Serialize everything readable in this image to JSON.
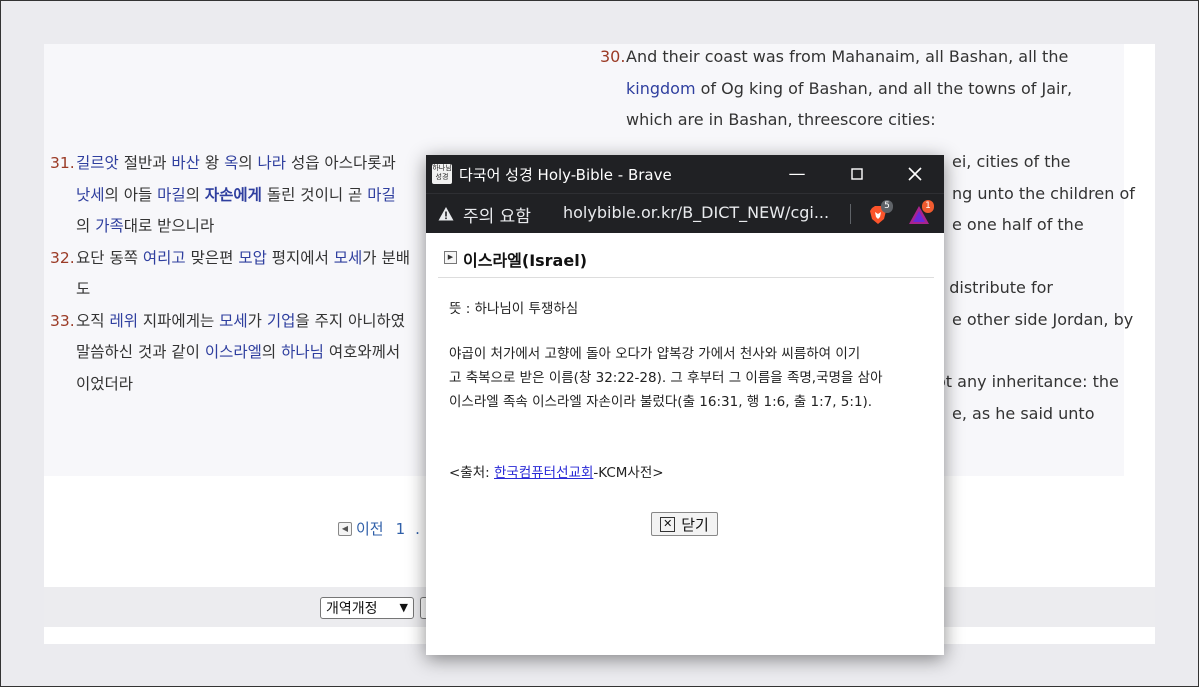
{
  "colors": {
    "verse_number": "#9b3b26",
    "word_link": "#2f3f9f",
    "titlebar": "#202124"
  },
  "korean_verses": [
    {
      "num": "31.",
      "parts": [
        {
          "t": "길르앗",
          "link": true
        },
        {
          "t": " 절반과 "
        },
        {
          "t": "바산",
          "link": true
        },
        {
          "t": " 왕 "
        },
        {
          "t": "옥",
          "link": true
        },
        {
          "t": "의 "
        },
        {
          "t": "나라",
          "link": true
        },
        {
          "t": " 성읍 아스다롯과"
        },
        {
          "br": true
        },
        {
          "t": "낫세",
          "link": true
        },
        {
          "t": "의 아들 "
        },
        {
          "t": "마길",
          "link": true
        },
        {
          "t": "의 "
        },
        {
          "t": "자손에게",
          "link": true,
          "bold": true
        },
        {
          "t": " 돌린 것이니 곧 "
        },
        {
          "t": "마길",
          "link": true
        },
        {
          "br": true
        },
        {
          "t": "의 "
        },
        {
          "t": "가족",
          "link": true
        },
        {
          "t": "대로 받으니라"
        }
      ]
    },
    {
      "num": "32.",
      "parts": [
        {
          "t": "요단 동쪽 "
        },
        {
          "t": "여리고",
          "link": true
        },
        {
          "t": " 맞은편 "
        },
        {
          "t": "모압",
          "link": true
        },
        {
          "t": " 평지에서 "
        },
        {
          "t": "모세",
          "link": true
        },
        {
          "t": "가 분배"
        },
        {
          "br": true
        },
        {
          "t": "도"
        }
      ]
    },
    {
      "num": "33.",
      "parts": [
        {
          "t": "오직 "
        },
        {
          "t": "레위",
          "link": true
        },
        {
          "t": " 지파에게는 "
        },
        {
          "t": "모세",
          "link": true
        },
        {
          "t": "가 "
        },
        {
          "t": "기업",
          "link": true
        },
        {
          "t": "을 주지 아니하였"
        },
        {
          "br": true
        },
        {
          "t": "말씀하신 것과 같이 "
        },
        {
          "t": "이스라엘",
          "link": true
        },
        {
          "t": "의 "
        },
        {
          "t": "하나님",
          "link": true
        },
        {
          "t": " 여호와께서"
        },
        {
          "br": true
        },
        {
          "t": "이었더라"
        }
      ]
    }
  ],
  "english_verse_30": {
    "num": "30.",
    "parts": [
      {
        "t": "And their coast was from Mahanaim, all Bashan, all the"
      },
      {
        "br": true
      },
      {
        "t": "kingdom",
        "link": true
      },
      {
        "t": " of Og king of Bashan, and all the towns of Jair,"
      },
      {
        "br": true
      },
      {
        "t": "which are in Bashan, threescore cities:"
      }
    ]
  },
  "english_fragments": [
    {
      "text": "ei, cities of the",
      "parts": []
    },
    {
      "text": "ng unto the children of",
      "parts": []
    },
    {
      "text": "e one half of the",
      "parts": []
    },
    {
      "text": "d distribute for",
      "parts": []
    },
    {
      "text": "e other side Jordan, by",
      "parts": []
    },
    {
      "text": "",
      "parts": [
        {
          "t": "ot any "
        },
        {
          "t": "inheritance",
          "link": true
        },
        {
          "t": ": the"
        }
      ]
    },
    {
      "text": "e, as he said unto",
      "parts": []
    }
  ],
  "pager": {
    "prev_label": "이전",
    "page1": "1",
    "ellipsis": ". ."
  },
  "toolbar": {
    "version_selected": "개역개정"
  },
  "popup": {
    "app_icon_text": "하나님 성경",
    "window_title": "다국어 성경 Holy-Bible - Brave",
    "security_label": "주의 요함",
    "url": "holybible.or.kr/B_DICT_NEW/cgi...",
    "shields_badge": "5",
    "rewards_badge": "1",
    "entry_title": "이스라엘(Israel)",
    "meaning": "뜻 : 하나님이 투쟁하심",
    "description_lines": [
      "야곱이 처가에서 고향에 돌아 오다가 얍복강 가에서 천사와 씨름하여 이기",
      "고 축복으로 받은 이름(창 32:22-28). 그 후부터 그 이름을 족명,국명을 삼아",
      "이스라엘 족속 이스라엘 자손이라 불렀다(출 16:31, 행 1:6, 출 1:7, 5:1)."
    ],
    "source_prefix": "<출처: ",
    "source_link": "한국컴퓨터선교회",
    "source_suffix": "-KCM사전>",
    "close_label": "닫기"
  }
}
